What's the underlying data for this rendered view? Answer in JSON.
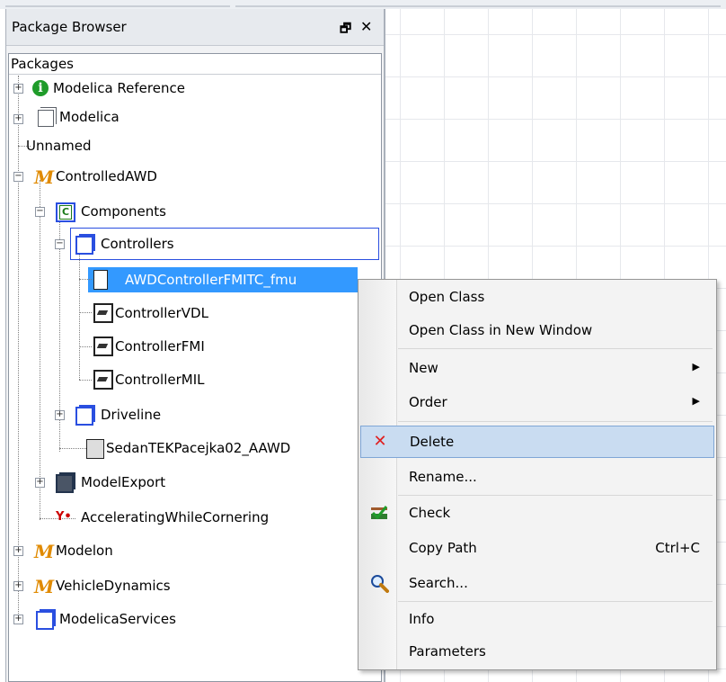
{
  "panel": {
    "title": "Package Browser",
    "float_icon": "float-window-icon",
    "close_icon": "close-icon",
    "tree_header": "Packages"
  },
  "tree": [
    {
      "label": "Modelica Reference",
      "icon": "info-icon",
      "expander": "+"
    },
    {
      "label": "Modelica",
      "icon": "package-icon",
      "expander": "+"
    },
    {
      "label": "Unnamed",
      "icon": "",
      "expander": ""
    },
    {
      "label": "ControlledAWD",
      "icon": "modelon-m-icon",
      "expander": "-"
    },
    {
      "label": "Components",
      "icon": "component-package-icon",
      "expander": "-"
    },
    {
      "label": "Controllers",
      "icon": "package-icon",
      "expander": "-"
    },
    {
      "label": "AWDControllerFMITC_fmu",
      "icon": "fmu-block-icon",
      "expander": ""
    },
    {
      "label": "ControllerVDL",
      "icon": "controller-block-icon",
      "expander": ""
    },
    {
      "label": "ControllerFMI",
      "icon": "controller-block-icon",
      "expander": ""
    },
    {
      "label": "ControllerMIL",
      "icon": "controller-block-icon",
      "expander": ""
    },
    {
      "label": "Driveline",
      "icon": "package-icon",
      "expander": "+"
    },
    {
      "label": "SedanTEKPacejka02_AAWD",
      "icon": "vehicle-model-icon",
      "expander": ""
    },
    {
      "label": "ModelExport",
      "icon": "dark-package-icon",
      "expander": "+"
    },
    {
      "label": "AcceleratingWhileCornering",
      "icon": "experiment-icon",
      "expander": ""
    },
    {
      "label": "Modelon",
      "icon": "modelon-m-icon",
      "expander": "+"
    },
    {
      "label": "VehicleDynamics",
      "icon": "modelon-m-icon",
      "expander": "+"
    },
    {
      "label": "ModelicaServices",
      "icon": "package-icon",
      "expander": "+"
    }
  ],
  "context_menu": {
    "items": [
      {
        "label": "Open Class",
        "icon": "",
        "shortcut": "",
        "submenu": false
      },
      {
        "label": "Open Class in New Window",
        "icon": "",
        "shortcut": "",
        "submenu": false
      },
      {
        "label": "New",
        "icon": "",
        "shortcut": "",
        "submenu": true
      },
      {
        "label": "Order",
        "icon": "",
        "shortcut": "",
        "submenu": true
      },
      {
        "label": "Delete",
        "icon": "delete-x-icon",
        "shortcut": "",
        "submenu": false,
        "highlighted": true
      },
      {
        "label": "Rename...",
        "icon": "",
        "shortcut": "",
        "submenu": false
      },
      {
        "label": "Check",
        "icon": "check-icon",
        "shortcut": "",
        "submenu": false
      },
      {
        "label": "Copy Path",
        "icon": "",
        "shortcut": "Ctrl+C",
        "submenu": false
      },
      {
        "label": "Search...",
        "icon": "search-icon",
        "shortcut": "",
        "submenu": false
      },
      {
        "label": "Info",
        "icon": "",
        "shortcut": "",
        "submenu": false
      },
      {
        "label": "Parameters",
        "icon": "",
        "shortcut": "",
        "submenu": false
      }
    ],
    "submenu_arrow": "▶",
    "delete_glyph": "✕",
    "highlight_color": "#c9dcf1"
  },
  "colors": {
    "selection": "#3399ff",
    "package_blue": "#2a4fe0",
    "modelon_orange": "#e08a00"
  }
}
